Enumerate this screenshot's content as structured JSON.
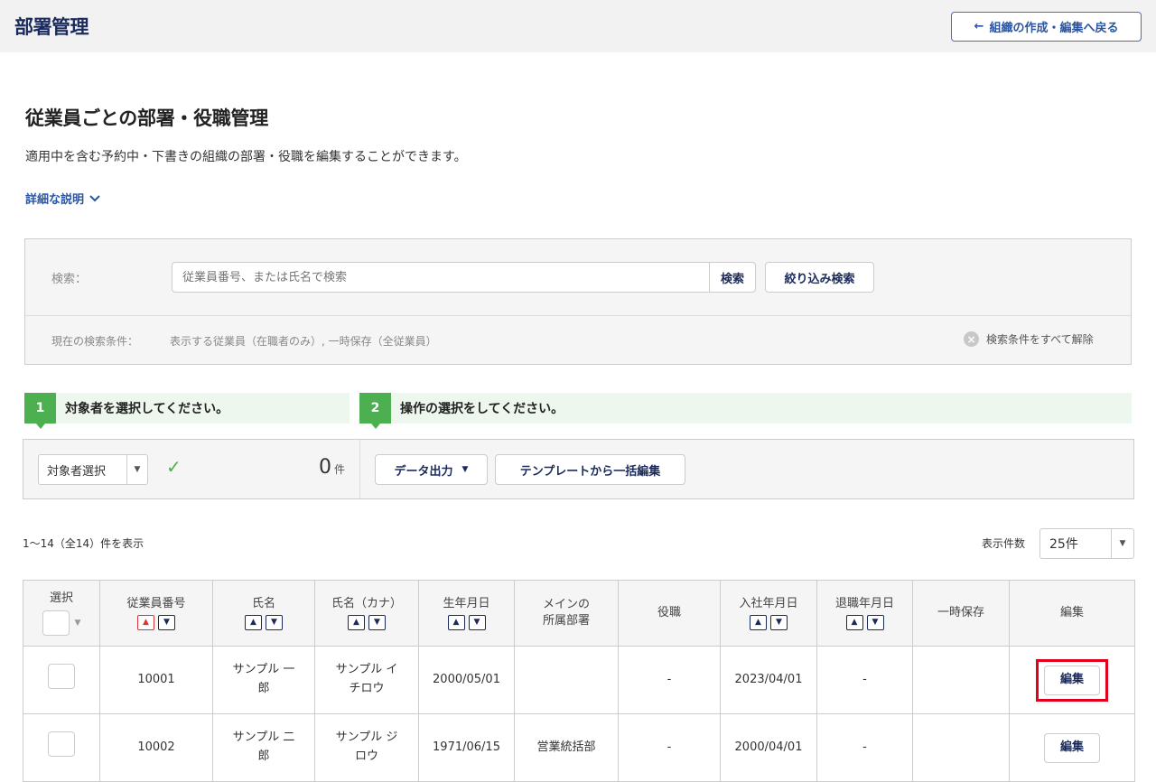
{
  "header": {
    "title": "部署管理",
    "back_label": "組織の作成・編集へ戻る"
  },
  "page": {
    "heading": "従業員ごとの部署・役職管理",
    "description": "適用中を含む予約中・下書きの組織の部署・役職を編集することができます。",
    "detail_link": "詳細な説明"
  },
  "search": {
    "label": "検索：",
    "placeholder": "従業員番号、または氏名で検索",
    "search_button": "検索",
    "filter_button": "絞り込み検索",
    "current_label": "現在の検索条件：",
    "current_value": "表示する従業員（在職者のみ）, 一時保存（全従業員）",
    "clear_all": "検索条件をすべて解除"
  },
  "steps": {
    "step1_num": "1",
    "step1_text": "対象者を選択してください。",
    "step2_num": "2",
    "step2_text": "操作の選択をしてください。"
  },
  "actions": {
    "target_select": "対象者選択",
    "count": "0",
    "count_unit": "件",
    "data_output": "データ出力",
    "template_edit": "テンプレートから一括編集"
  },
  "listing": {
    "range": "1〜14（全14）件を表示",
    "per_page_label": "表示件数",
    "per_page": "25件"
  },
  "table": {
    "headers": {
      "select": "選択",
      "emp_no": "従業員番号",
      "name": "氏名",
      "kana": "氏名（カナ）",
      "birth": "生年月日",
      "dept_1": "メインの",
      "dept_2": "所属部署",
      "position": "役職",
      "join": "入社年月日",
      "retire": "退職年月日",
      "temp": "一時保存",
      "edit": "編集"
    },
    "rows": [
      {
        "emp_no": "10001",
        "name_1": "サンプル 一",
        "name_2": "郎",
        "kana_1": "サンプル イ",
        "kana_2": "チロウ",
        "birth": "2000/05/01",
        "dept": "",
        "position": "-",
        "join": "2023/04/01",
        "retire": "-",
        "temp": "",
        "edit": "編集"
      },
      {
        "emp_no": "10002",
        "name_1": "サンプル 二",
        "name_2": "郎",
        "kana_1": "サンプル ジ",
        "kana_2": "ロウ",
        "birth": "1971/06/15",
        "dept": "営業統括部",
        "position": "-",
        "join": "2000/04/01",
        "retire": "-",
        "temp": "",
        "edit": "編集"
      }
    ]
  },
  "colors": {
    "accent": "#1a2a5c",
    "step_green": "#4caf50",
    "highlight": "#e3001b"
  }
}
